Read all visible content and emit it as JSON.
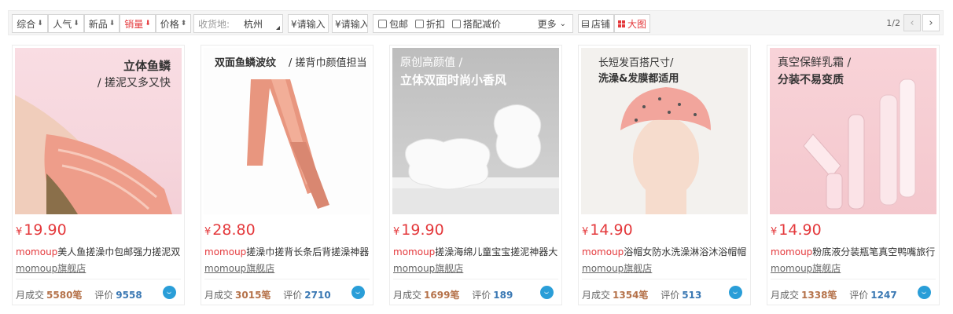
{
  "sort": {
    "comprehensive": "综合",
    "popularity": "人气",
    "new": "新品",
    "sales": "销量",
    "price": "价格"
  },
  "location": {
    "label": "收货地:",
    "city": "杭州"
  },
  "price_range": {
    "min_placeholder": "¥请输入",
    "max_placeholder": "¥请输入"
  },
  "filters": {
    "free_shipping": "包邮",
    "discount": "折扣",
    "bundle_deal": "搭配减价",
    "more": "更多"
  },
  "view": {
    "shop": "店铺",
    "big_image": "大图"
  },
  "pager": {
    "text": "1/2"
  },
  "colors": {
    "accent": "#e4393c",
    "sales": "#b5724a",
    "reviews": "#3a78b3"
  },
  "products": [
    {
      "image_line1": "立体鱼鳞",
      "image_line2": "/ 搓泥又多又快",
      "price": "19.90",
      "brand": "momoup",
      "title": "美人鱼搓澡巾包邮强力搓泥双",
      "shop": "momoup旗舰店",
      "sales_label": "月成交",
      "sales": "5580笔",
      "reviews_label": "评价",
      "reviews": "9558"
    },
    {
      "image_line1": "双面鱼鳞波纹",
      "image_line2": "/ 搓背巾颜值担当",
      "price": "28.80",
      "brand": "momoup",
      "title": "搓澡巾搓背长条后背搓澡神器",
      "shop": "momoup旗舰店",
      "sales_label": "月成交",
      "sales": "3015笔",
      "reviews_label": "评价",
      "reviews": "2710"
    },
    {
      "image_line1": "原创高颜值 /",
      "image_line2": "立体双面时尚小香风",
      "price": "19.90",
      "brand": "momoup",
      "title": "搓澡海绵儿童宝宝搓泥神器大",
      "shop": "momoup旗舰店",
      "sales_label": "月成交",
      "sales": "1699笔",
      "reviews_label": "评价",
      "reviews": "189"
    },
    {
      "image_line1": "长短发百搭尺寸/",
      "image_line2": "洗澡&发膜都适用",
      "price": "14.90",
      "brand": "momoup",
      "title": "浴帽女防水洗澡淋浴沐浴帽帽",
      "shop": "momoup旗舰店",
      "sales_label": "月成交",
      "sales": "1354笔",
      "reviews_label": "评价",
      "reviews": "513"
    },
    {
      "image_line1": "真空保鲜乳霜 /",
      "image_line2": "分装不易变质",
      "price": "14.90",
      "brand": "momoup",
      "title": "粉底液分装瓶笔真空鸭嘴旅行",
      "shop": "momoup旗舰店",
      "sales_label": "月成交",
      "sales": "1338笔",
      "reviews_label": "评价",
      "reviews": "1247"
    }
  ]
}
